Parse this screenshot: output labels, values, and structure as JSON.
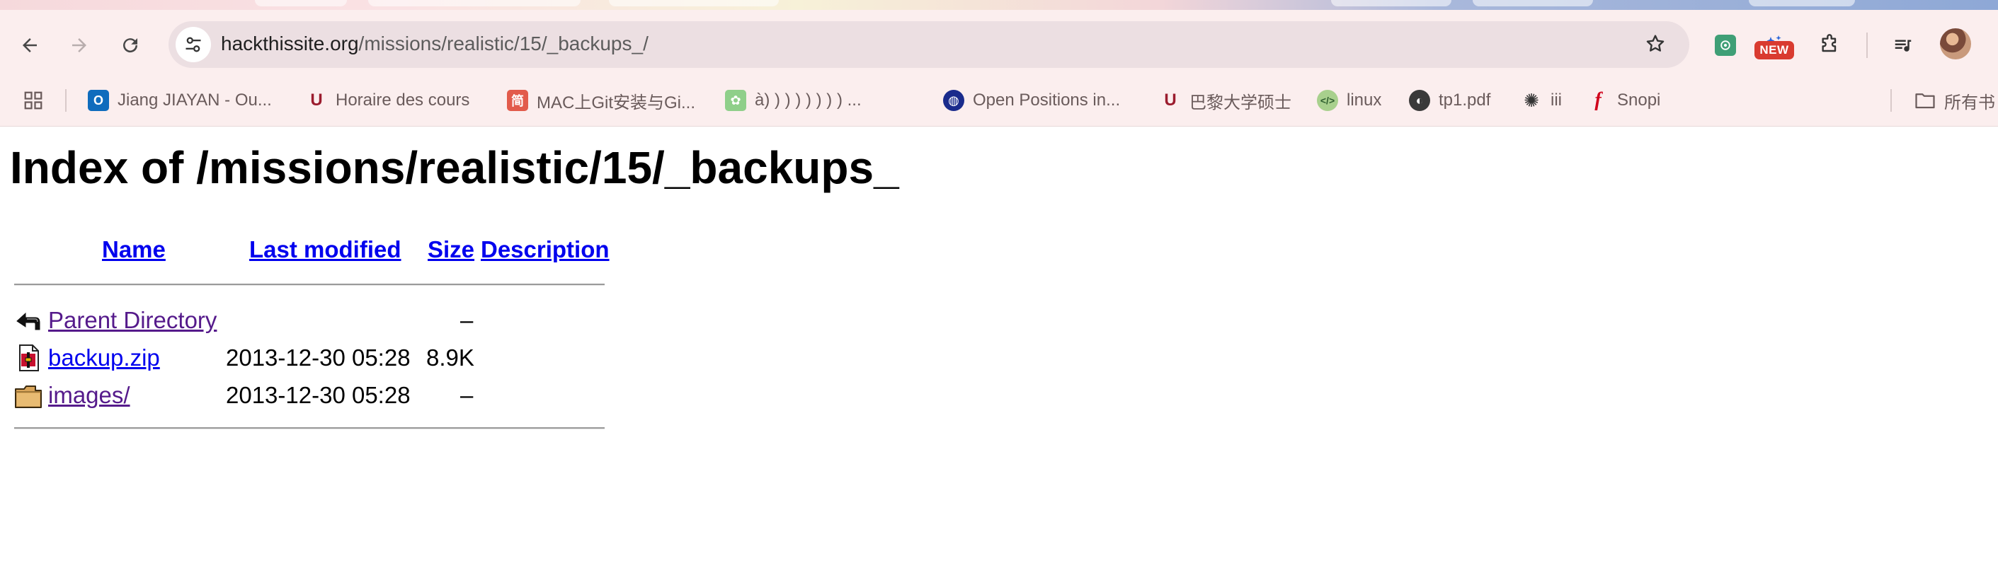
{
  "browser": {
    "url_host": "hackthissite.org",
    "url_path": "/missions/realistic/15/_backups_/",
    "new_badge": "NEW",
    "bookmarks": [
      {
        "label": "Jiang JIAYAN - Ou...",
        "icon": "outlook-icon"
      },
      {
        "label": "Horaire des cours",
        "icon": "university-logo-icon"
      },
      {
        "label": "MAC上Git安装与Gi...",
        "icon": "jianshu-icon"
      },
      {
        "label": "à) ) ) ) ) ) ) ) ...",
        "icon": "paw-icon"
      },
      {
        "label": "Open Positions in...",
        "icon": "globe-blue-icon"
      },
      {
        "label": "巴黎大学硕士",
        "icon": "university-logo-icon"
      },
      {
        "label": "linux",
        "icon": "code-icon"
      },
      {
        "label": "tp1.pdf",
        "icon": "globe-icon"
      },
      {
        "label": "iii",
        "icon": "openai-icon"
      },
      {
        "label": "Snopi",
        "icon": "flash-icon"
      }
    ],
    "all_bookmarks_label": "所有书"
  },
  "page": {
    "title": "Index of /missions/realistic/15/_backups_",
    "columns": {
      "name": "Name",
      "last_modified": "Last modified",
      "size": "Size",
      "description": "Description"
    },
    "rows": [
      {
        "name": "Parent Directory",
        "modified": "",
        "size": "–",
        "description": "",
        "icon": "back-arrow-icon",
        "visited": true
      },
      {
        "name": "backup.zip",
        "modified": "2013-12-30 05:28",
        "size": "8.9K",
        "description": "",
        "icon": "compressed-file-icon",
        "visited": false
      },
      {
        "name": "images/",
        "modified": "2013-12-30 05:28",
        "size": "–",
        "description": "",
        "icon": "folder-icon",
        "visited": true
      }
    ]
  },
  "colors": {
    "link": "#0000ee",
    "visited_link": "#551a8b",
    "chrome_bg": "#fbeeee",
    "omnibox_bg": "#ecdfe2"
  }
}
